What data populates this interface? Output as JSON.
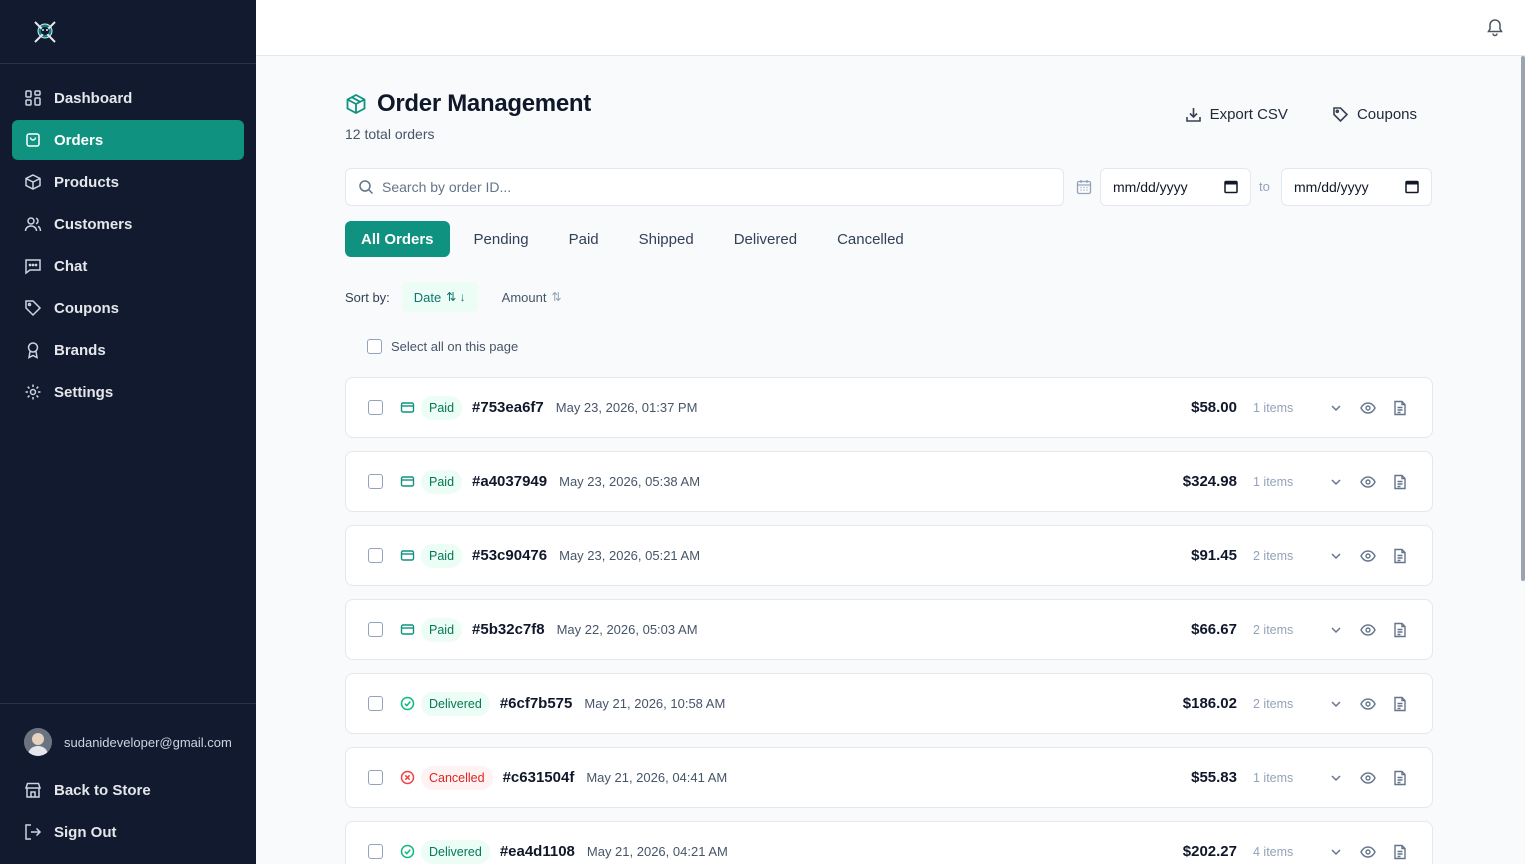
{
  "sidebar": {
    "nav": [
      {
        "label": "Dashboard",
        "icon": "dashboard-icon"
      },
      {
        "label": "Orders",
        "icon": "orders-icon",
        "active": true
      },
      {
        "label": "Products",
        "icon": "products-icon"
      },
      {
        "label": "Customers",
        "icon": "customers-icon"
      },
      {
        "label": "Chat",
        "icon": "chat-icon"
      },
      {
        "label": "Coupons",
        "icon": "coupon-icon"
      },
      {
        "label": "Brands",
        "icon": "brands-icon"
      },
      {
        "label": "Settings",
        "icon": "settings-icon"
      }
    ],
    "user_email": "sudanideveloper@gmail.com",
    "back_to_store": "Back to Store",
    "sign_out": "Sign Out"
  },
  "header": {
    "title": "Order Management",
    "subtitle": "12 total orders",
    "export_label": "Export CSV",
    "coupons_label": "Coupons"
  },
  "filters": {
    "search_placeholder": "Search by order ID...",
    "date_from": "mm/dd/yyyy",
    "date_to": "mm/dd/yyyy",
    "to_label": "to"
  },
  "tabs": [
    "All Orders",
    "Pending",
    "Paid",
    "Shipped",
    "Delivered",
    "Cancelled"
  ],
  "sort": {
    "label": "Sort by:",
    "date_label": "Date",
    "amount_label": "Amount"
  },
  "select_all_label": "Select all on this page",
  "orders": [
    {
      "status": "Paid",
      "id": "#753ea6f7",
      "date": "May 23, 2026, 01:37 PM",
      "amount": "$58.00",
      "items": "1 items"
    },
    {
      "status": "Paid",
      "id": "#a4037949",
      "date": "May 23, 2026, 05:38 AM",
      "amount": "$324.98",
      "items": "1 items"
    },
    {
      "status": "Paid",
      "id": "#53c90476",
      "date": "May 23, 2026, 05:21 AM",
      "amount": "$91.45",
      "items": "2 items"
    },
    {
      "status": "Paid",
      "id": "#5b32c7f8",
      "date": "May 22, 2026, 05:03 AM",
      "amount": "$66.67",
      "items": "2 items"
    },
    {
      "status": "Delivered",
      "id": "#6cf7b575",
      "date": "May 21, 2026, 10:58 AM",
      "amount": "$186.02",
      "items": "2 items"
    },
    {
      "status": "Cancelled",
      "id": "#c631504f",
      "date": "May 21, 2026, 04:41 AM",
      "amount": "$55.83",
      "items": "1 items"
    },
    {
      "status": "Delivered",
      "id": "#ea4d1108",
      "date": "May 21, 2026, 04:21 AM",
      "amount": "$202.27",
      "items": "4 items"
    }
  ],
  "colors": {
    "accent": "#0f9280",
    "sidebar_bg": "#111a2e",
    "paid": "#047857",
    "cancelled": "#dc2626"
  }
}
